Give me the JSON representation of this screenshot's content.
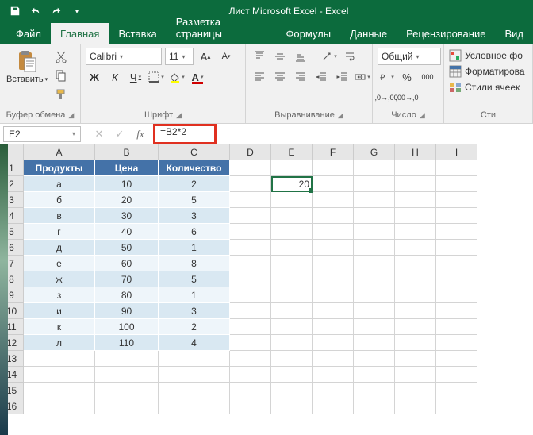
{
  "title": "Лист Microsoft Excel  -  Excel",
  "tabs": [
    "Файл",
    "Главная",
    "Вставка",
    "Разметка страницы",
    "Формулы",
    "Данные",
    "Рецензирование",
    "Вид"
  ],
  "active_tab": 1,
  "clipboard": {
    "paste": "Вставить",
    "group": "Буфер обмена"
  },
  "font": {
    "name": "Calibri",
    "size": "11",
    "bold": "Ж",
    "italic": "К",
    "underline": "Ч",
    "group": "Шрифт"
  },
  "align": {
    "group": "Выравнивание"
  },
  "number": {
    "format": "Общий",
    "group": "Число"
  },
  "styles": {
    "cond": "Условное фо",
    "table": "Форматирова",
    "cell": "Стили ячеек",
    "group": "Сти"
  },
  "namebox": "E2",
  "formula": "=B2*2",
  "columns": [
    "A",
    "B",
    "C",
    "D",
    "E",
    "F",
    "G",
    "H",
    "I"
  ],
  "headers": [
    "Продукты",
    "Цена",
    "Количество"
  ],
  "table": [
    {
      "p": "а",
      "c": "10",
      "k": "2"
    },
    {
      "p": "б",
      "c": "20",
      "k": "5"
    },
    {
      "p": "в",
      "c": "30",
      "k": "3"
    },
    {
      "p": "г",
      "c": "40",
      "k": "6"
    },
    {
      "p": "д",
      "c": "50",
      "k": "1"
    },
    {
      "p": "е",
      "c": "60",
      "k": "8"
    },
    {
      "p": "ж",
      "c": "70",
      "k": "5"
    },
    {
      "p": "з",
      "c": "80",
      "k": "1"
    },
    {
      "p": "и",
      "c": "90",
      "k": "3"
    },
    {
      "p": "к",
      "c": "100",
      "k": "2"
    },
    {
      "p": "л",
      "c": "110",
      "k": "4"
    }
  ],
  "e2_value": "20",
  "visible_rows": 16
}
